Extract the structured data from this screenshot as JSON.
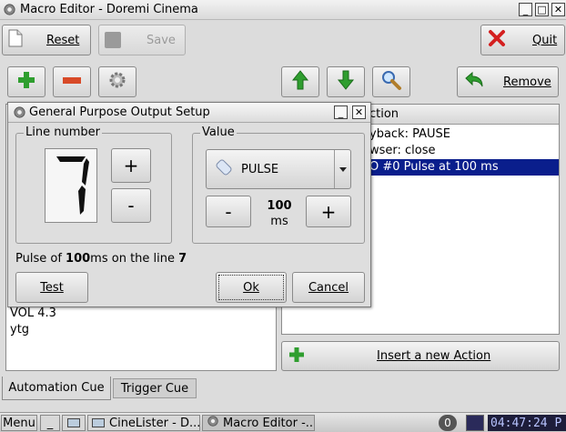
{
  "window": {
    "title": "Macro Editor - Doremi Cinema"
  },
  "toolbar": {
    "reset": "Reset",
    "save": "Save",
    "quit": "Quit",
    "remove": "Remove"
  },
  "left_list": {
    "items": [
      "VOL 4.3",
      "ytg"
    ]
  },
  "right_list": {
    "header": "ction",
    "rows": [
      "yback: PAUSE",
      "wser: close",
      "O #0 Pulse at 100 ms"
    ],
    "selected_index": 2
  },
  "insert_action": "Insert a new Action",
  "tabs": [
    {
      "label": "Automation Cue",
      "active": true
    },
    {
      "label": "Trigger Cue",
      "active": false
    }
  ],
  "dialog": {
    "title": "General Purpose Output Setup",
    "line_group": "Line number",
    "line_value": "7",
    "plus": "+",
    "minus": "-",
    "value_group": "Value",
    "value_select": "PULSE",
    "value_minus": "-",
    "value_plus": "+",
    "duration_value": "100",
    "duration_unit": "ms",
    "summary_pre": "Pulse of ",
    "summary_duration": "100",
    "summary_mid": "ms on the line ",
    "summary_line": "7",
    "test": "Test",
    "ok": "Ok",
    "cancel": "Cancel"
  },
  "taskbar": {
    "menu": "Menu",
    "task1": "CineLister - D...",
    "task2": "Macro Editor -...",
    "badge": "0",
    "clock": "04:47:24 P"
  },
  "colors": {
    "selection": "#0a1e8c",
    "window_bg": "#dcdcdc",
    "clock_bg": "#1d1d3a",
    "clock_text": "#b8c4ff"
  }
}
